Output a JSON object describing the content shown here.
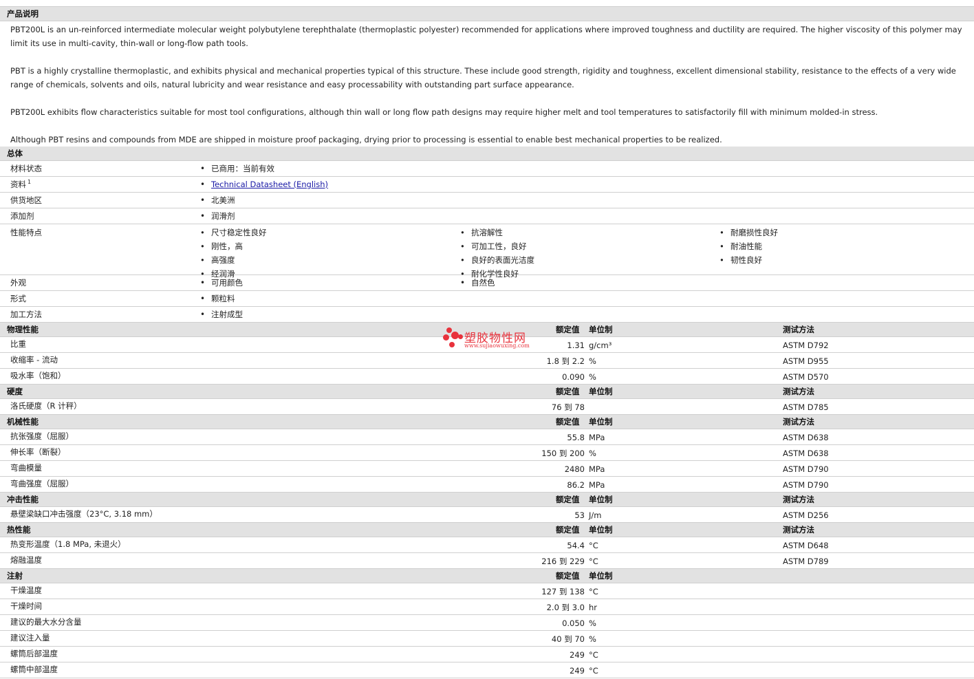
{
  "description": {
    "title": "产品说明",
    "paragraphs": [
      "PBT200L is an un-reinforced intermediate molecular weight polybutylene terephthalate (thermoplastic polyester) recommended for applications where improved toughness and ductility are required. The higher viscosity of this polymer may limit its use in multi-cavity, thin-wall or long-flow path tools.",
      "PBT is a highly crystalline thermoplastic, and exhibits physical and mechanical properties typical of this structure. These include good strength, rigidity and toughness, excellent dimensional stability, resistance to the effects of a very wide range of chemicals, solvents and oils, natural lubricity and wear resistance and easy processability with outstanding part surface appearance.",
      "PBT200L exhibits flow characteristics suitable for most tool configurations, although thin wall or long flow path designs may require higher melt and tool temperatures to satisfactorily fill with minimum molded-in stress.",
      "Although PBT resins and compounds from MDE are shipped in moisture proof packaging, drying prior to processing is essential to enable best mechanical properties to be realized."
    ]
  },
  "general": {
    "title": "总体",
    "material_status_label": "材料状态",
    "material_status_value": "已商用：当前有效",
    "resources_label": "资料",
    "resources_sup": "1",
    "resources_link": "Technical Datasheet (English)",
    "region_label": "供货地区",
    "region_value": "北美洲",
    "additive_label": "添加剂",
    "additive_value": "润滑剂",
    "features_label": "性能特点",
    "features_col1": [
      "尺寸稳定性良好",
      "刚性，高",
      "高强度",
      "经润滑"
    ],
    "features_col2": [
      "抗溶解性",
      "可加工性，良好",
      "良好的表面光洁度",
      "耐化学性良好"
    ],
    "features_col3": [
      "耐磨损性良好",
      "耐油性能",
      "韧性良好"
    ],
    "appearance_label": "外观",
    "appearance_values": [
      "可用颜色",
      "自然色"
    ],
    "form_label": "形式",
    "form_value": "颗粒料",
    "process_label": "加工方法",
    "process_value": "注射成型"
  },
  "headers": {
    "nominal": "额定值",
    "unit": "单位制",
    "method": "测试方法"
  },
  "watermark": {
    "name": "塑胶物性网",
    "url": "www.sujiaowuxing.com"
  },
  "physical": {
    "title": "物理性能",
    "rows": [
      {
        "label": "比重",
        "value": "1.31",
        "unit": "g/cm³",
        "method": "ASTM D792"
      },
      {
        "label": "收缩率 - 流动",
        "value": "1.8 到  2.2",
        "unit": "%",
        "method": "ASTM D955"
      },
      {
        "label": "吸水率（饱和）",
        "value": "0.090",
        "unit": "%",
        "method": "ASTM D570"
      }
    ]
  },
  "hardness": {
    "title": "硬度",
    "rows": [
      {
        "label": "洛氏硬度（R 计秤）",
        "value": "76 到  78",
        "unit": "",
        "method": "ASTM D785"
      }
    ]
  },
  "mechanical": {
    "title": "机械性能",
    "rows": [
      {
        "label": "抗张强度（屈服）",
        "value": "55.8",
        "unit": "MPa",
        "method": "ASTM D638"
      },
      {
        "label": "伸长率（断裂）",
        "value": "150 到  200",
        "unit": "%",
        "method": "ASTM D638"
      },
      {
        "label": "弯曲模量",
        "value": "2480",
        "unit": "MPa",
        "method": "ASTM D790"
      },
      {
        "label": "弯曲强度（屈服）",
        "value": "86.2",
        "unit": "MPa",
        "method": "ASTM D790"
      }
    ]
  },
  "impact": {
    "title": "冲击性能",
    "rows": [
      {
        "label": "悬壁梁缺口冲击强度（23°C, 3.18 mm）",
        "value": "53",
        "unit": "J/m",
        "method": "ASTM D256"
      }
    ]
  },
  "thermal": {
    "title": "热性能",
    "rows": [
      {
        "label": "热变形温度（1.8 MPa, 未退火）",
        "value": "54.4",
        "unit": "°C",
        "method": "ASTM D648"
      },
      {
        "label": "熔融温度",
        "value": "216 到  229",
        "unit": "°C",
        "method": "ASTM D789"
      }
    ]
  },
  "injection": {
    "title": "注射",
    "rows": [
      {
        "label": "干燥温度",
        "value": "127 到  138",
        "unit": "°C",
        "method": ""
      },
      {
        "label": "干燥时间",
        "value": "2.0 到  3.0",
        "unit": "hr",
        "method": ""
      },
      {
        "label": "建议的最大水分含量",
        "value": "0.050",
        "unit": "%",
        "method": ""
      },
      {
        "label": "建议注入量",
        "value": "40 到  70",
        "unit": "%",
        "method": ""
      },
      {
        "label": "螺筒后部温度",
        "value": "249",
        "unit": "°C",
        "method": ""
      },
      {
        "label": "螺筒中部温度",
        "value": "249",
        "unit": "°C",
        "method": ""
      }
    ]
  }
}
